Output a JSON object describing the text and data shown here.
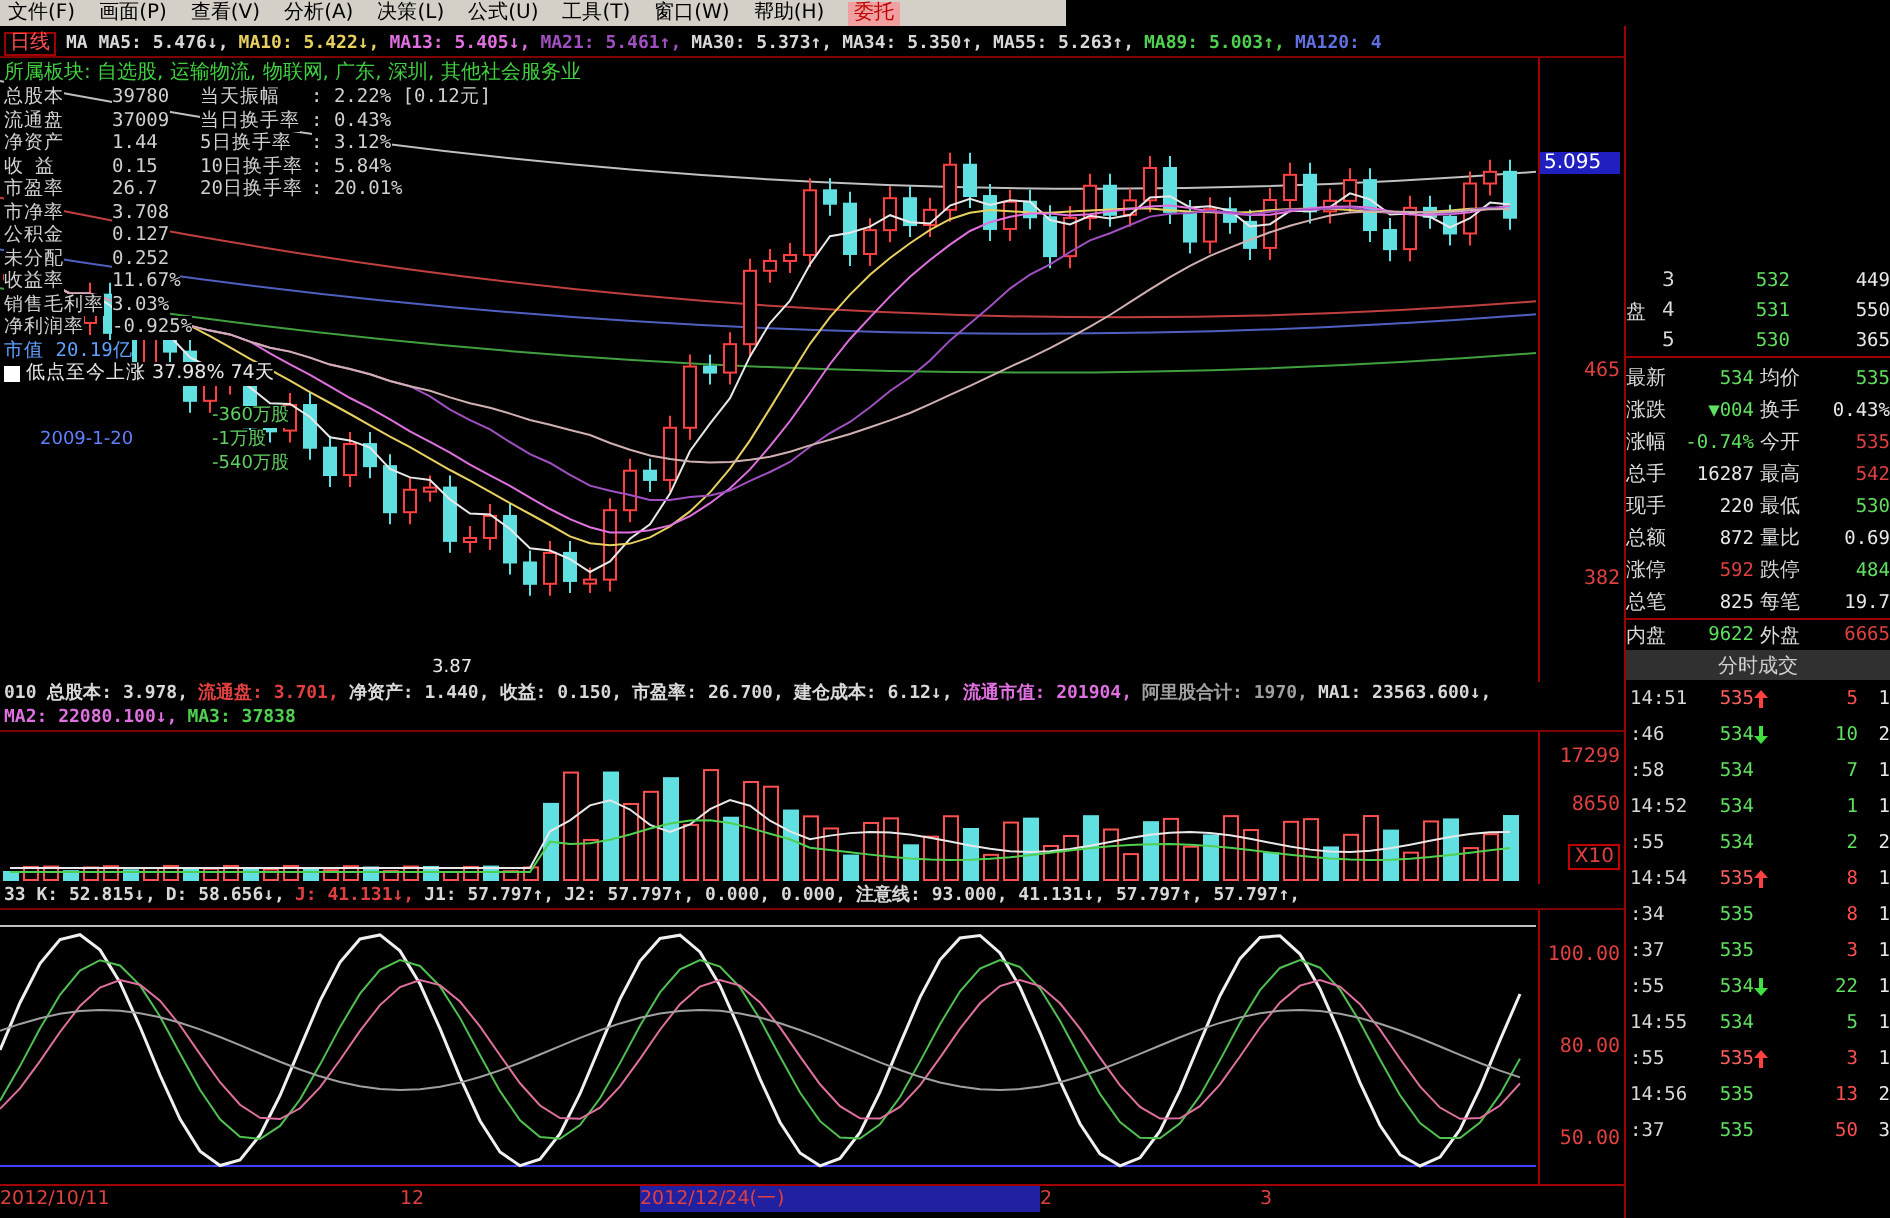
{
  "menu_bar": {
    "items": [
      "文件(F)",
      "画面(P)",
      "查看(V)",
      "分析(A)",
      "决策(L)",
      "公式(U)",
      "工具(T)",
      "窗口(W)",
      "帮助(H)"
    ],
    "trade_button": "委托"
  },
  "ma_bar": {
    "title": "日线",
    "values": [
      {
        "text": "MA MA5: 5.476↓,",
        "color": "#d8d8d8"
      },
      {
        "text": "MA10: 5.422↓,",
        "color": "#e8d060"
      },
      {
        "text": "MA13: 5.405↓,",
        "color": "#e070e0"
      },
      {
        "text": "MA21: 5.461↑,",
        "color": "#a050c0"
      },
      {
        "text": "MA30: 5.373↑,",
        "color": "#d8d8d8"
      },
      {
        "text": "MA34: 5.350↑,",
        "color": "#d8d8d8"
      },
      {
        "text": "MA55: 5.263↑,",
        "color": "#d8d8d8"
      },
      {
        "text": "MA89: 5.003↑,",
        "color": "#50d050"
      },
      {
        "text": "MA120: 4",
        "color": "#6070e0"
      }
    ]
  },
  "info_panel": {
    "sector": "所属板块: 自选股, 运输物流, 物联网, 广东, 深圳, 其他社会服务业",
    "rows": [
      {
        "label": "总股本",
        "value": "39780",
        "label_2": "当天振幅",
        "value_2": ": 2.22% [0.12元]"
      },
      {
        "label": "流通盘",
        "value": "37009",
        "label_2": "当日换手率",
        "value_2": ": 0.43%"
      },
      {
        "label": "净资产",
        "value": "1.44",
        "label_2": "5日换手率",
        "value_2": ": 3.12%"
      },
      {
        "label": "收 益",
        "value": "0.15",
        "label_2": "10日换手率",
        "value_2": ": 5.84%"
      },
      {
        "label": "市盈率",
        "value": "26.7",
        "label_2": "20日换手率",
        "value_2": ": 20.01%"
      },
      {
        "label": "市净率",
        "value": "3.708"
      },
      {
        "label": "公积金",
        "value": "0.127"
      },
      {
        "label": "未分配",
        "value": "0.252"
      },
      {
        "label": "收益率",
        "value": "11.67%"
      },
      {
        "label": "销售毛利率",
        "value": "3.03%"
      },
      {
        "label": "净利润率",
        "value": "-0.925%"
      }
    ],
    "market_value": "市值 20.19亿",
    "rise_note": "低点至今上涨 37.98%  74天"
  },
  "chart_notes": {
    "date": "2009-1-20",
    "flows": [
      "-360万股",
      "-1万股",
      "-540万股"
    ],
    "low_price": "3.87"
  },
  "price_axis": {
    "current": "5.095",
    "labels": [
      "465",
      "382"
    ]
  },
  "volume_bar": {
    "values": [
      {
        "text": "010 总股本: 3.978,",
        "color": "#d8d8d8"
      },
      {
        "text": "流通盘: 3.701,",
        "color": "#e04040"
      },
      {
        "text": "净资产: 1.440,",
        "color": "#d8d8d8"
      },
      {
        "text": "收益: 0.150,",
        "color": "#d8d8d8"
      },
      {
        "text": "市盈率: 26.700,",
        "color": "#d8d8d8"
      },
      {
        "text": "建仓成本: 6.12↓,",
        "color": "#d8d8d8"
      },
      {
        "text": "流通市值: 201904,",
        "color": "#e070e0"
      },
      {
        "text": "阿里股合计: 1970,",
        "color": "#a0a0a0"
      },
      {
        "text": "MA1: 23563.600↓,",
        "color": "#d8d8d8"
      },
      {
        "text": "MA2: 22080.100↓,",
        "color": "#e070e0"
      },
      {
        "text": "MA3: 37838",
        "color": "#50d050"
      }
    ]
  },
  "volume_axis": {
    "labels": [
      "17299",
      "8650"
    ],
    "scale": "X10"
  },
  "indicator_bar": {
    "values": [
      {
        "text": "33 K: 52.815↓,",
        "color": "#d8d8d8"
      },
      {
        "text": "D: 58.656↓,",
        "color": "#d8d8d8"
      },
      {
        "text": "J: 41.131↓,",
        "color": "#e04040"
      },
      {
        "text": "J1: 57.797↑,",
        "color": "#d8d8d8"
      },
      {
        "text": "J2: 57.797↑, 0.000, 0.000,",
        "color": "#d8d8d8"
      },
      {
        "text": "注意线: 93.000, 41.131↓, 57.797↑, 57.797↑,",
        "color": "#d8d8d8"
      }
    ]
  },
  "indicator_axis": {
    "labels": [
      "100.00",
      "80.00",
      "50.00"
    ]
  },
  "date_axis": {
    "labels": [
      "2012/10/11",
      "12",
      "2012/12/24(一)",
      "2",
      "3"
    ]
  },
  "order_book": {
    "side_label": "盘",
    "rows": [
      {
        "level": "3",
        "price": "532",
        "volume": "449"
      },
      {
        "level": "4",
        "price": "531",
        "volume": "550"
      },
      {
        "level": "5",
        "price": "530",
        "volume": "365"
      }
    ]
  },
  "quote": {
    "rows": [
      {
        "left": {
          "label": "最新",
          "value": "534",
          "color": "#60e060"
        },
        "right": {
          "label": "均价",
          "value": "535",
          "color": "#60e060"
        }
      },
      {
        "left": {
          "label": "涨跌",
          "value": "▼004",
          "color": "#60e060"
        },
        "right": {
          "label": "换手",
          "value": "0.43%",
          "color": "#e8e8e8"
        }
      },
      {
        "left": {
          "label": "涨幅",
          "value": "-0.74%",
          "color": "#60e060"
        },
        "right": {
          "label": "今开",
          "value": "535",
          "color": "#e04040"
        }
      },
      {
        "left": {
          "label": "总手",
          "value": "16287",
          "color": "#e8e8e8"
        },
        "right": {
          "label": "最高",
          "value": "542",
          "color": "#e04040"
        }
      },
      {
        "left": {
          "label": "现手",
          "value": "220",
          "color": "#e8e8e8"
        },
        "right": {
          "label": "最低",
          "value": "530",
          "color": "#60e060"
        }
      },
      {
        "left": {
          "label": "总额",
          "value": "872",
          "color": "#e8e8e8"
        },
        "right": {
          "label": "量比",
          "value": "0.69",
          "color": "#e8e8e8"
        }
      },
      {
        "left": {
          "label": "涨停",
          "value": "592",
          "color": "#e04040"
        },
        "right": {
          "label": "跌停",
          "value": "484",
          "color": "#60e060"
        }
      },
      {
        "left": {
          "label": "总笔",
          "value": "825",
          "color": "#e8e8e8"
        },
        "right": {
          "label": "每笔",
          "value": "19.7",
          "color": "#e8e8e8"
        }
      }
    ],
    "inner": {
      "label": "内盘",
      "value": "9622"
    },
    "outer": {
      "label": "外盘",
      "value": "6665"
    }
  },
  "trades": {
    "title": "分时成交",
    "rows": [
      {
        "time": "14:51",
        "price": "535",
        "kind": "up",
        "volume": "5",
        "color": "#ff5050",
        "count": "1"
      },
      {
        "time": ":46",
        "price": "534",
        "kind": "down",
        "volume": "10",
        "color": "#60e060",
        "count": "2"
      },
      {
        "time": ":58",
        "price": "534",
        "kind": "flat",
        "volume": "7",
        "color": "#60e060",
        "count": "1"
      },
      {
        "time": "14:52",
        "price": "534",
        "kind": "flat",
        "volume": "1",
        "color": "#60e060",
        "count": "1"
      },
      {
        "time": ":55",
        "price": "534",
        "kind": "flat",
        "volume": "2",
        "color": "#60e060",
        "count": "2"
      },
      {
        "time": "14:54",
        "price": "535",
        "kind": "up",
        "volume": "8",
        "color": "#ff5050",
        "count": "1"
      },
      {
        "time": ":34",
        "price": "535",
        "kind": "flat",
        "volume": "8",
        "color": "#ff5050",
        "count": "1"
      },
      {
        "time": ":37",
        "price": "535",
        "kind": "flat",
        "volume": "3",
        "color": "#ff5050",
        "count": "1"
      },
      {
        "time": ":55",
        "price": "534",
        "kind": "down",
        "volume": "22",
        "color": "#60e060",
        "count": "1"
      },
      {
        "time": "14:55",
        "price": "534",
        "kind": "flat",
        "volume": "5",
        "color": "#60e060",
        "count": "1"
      },
      {
        "time": ":55",
        "price": "535",
        "kind": "up",
        "volume": "3",
        "color": "#ff5050",
        "count": "1"
      },
      {
        "time": "14:56",
        "price": "535",
        "kind": "flat",
        "volume": "13",
        "color": "#ff5050",
        "count": "2"
      },
      {
        "time": ":37",
        "price": "535",
        "kind": "flat",
        "volume": "50",
        "color": "#ff5050",
        "count": "3"
      }
    ]
  }
}
